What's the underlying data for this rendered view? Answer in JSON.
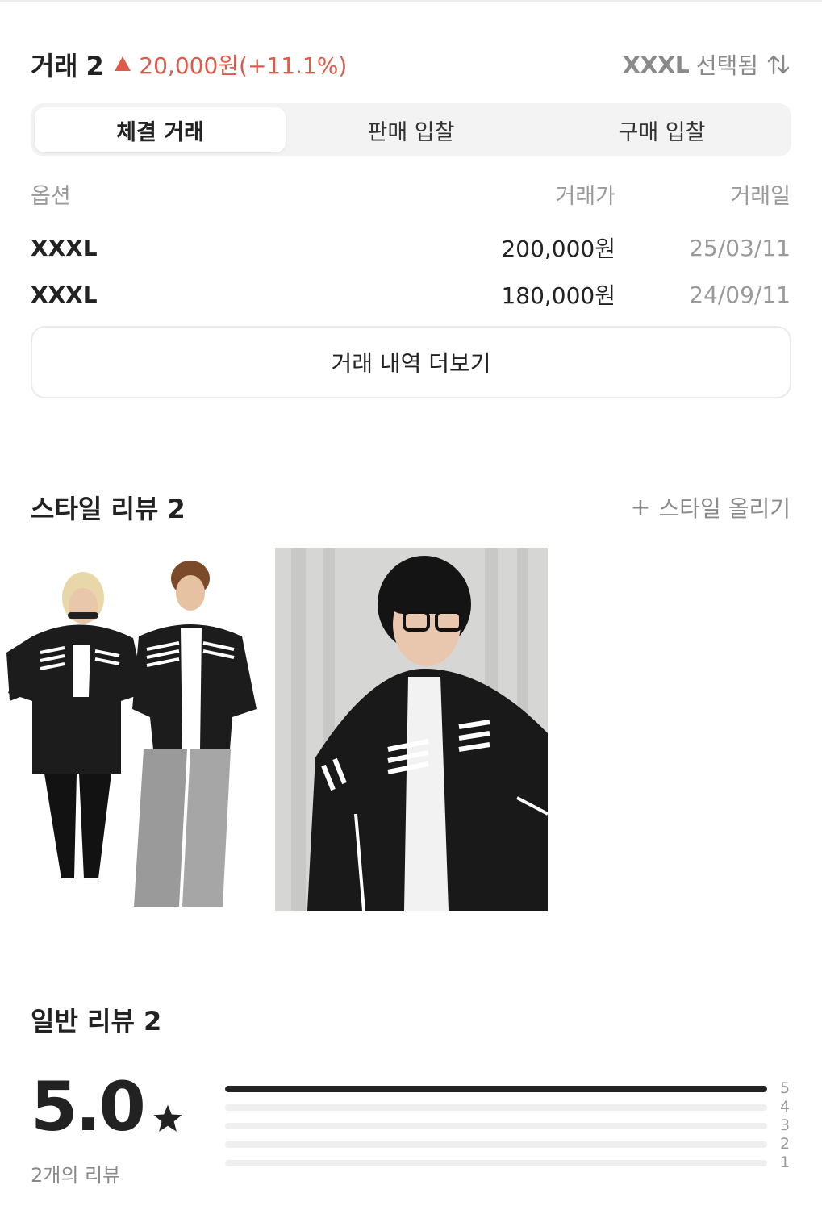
{
  "trade": {
    "title": "거래 2",
    "change": "20,000원(+11.1%)",
    "selected_size": "XXXL",
    "selected_suffix": "선택됨"
  },
  "tabs": [
    {
      "label": "체결 거래",
      "active": true
    },
    {
      "label": "판매 입찰",
      "active": false
    },
    {
      "label": "구매 입찰",
      "active": false
    }
  ],
  "table": {
    "headers": {
      "option": "옵션",
      "price": "거래가",
      "date": "거래일"
    },
    "rows": [
      {
        "option": "XXXL",
        "price": "200,000원",
        "date": "25/03/11"
      },
      {
        "option": "XXXL",
        "price": "180,000원",
        "date": "24/09/11"
      }
    ]
  },
  "more_button": "거래 내역 더보기",
  "style_review": {
    "title": "스타일 리뷰 2",
    "upload": "스타일 올리기"
  },
  "general_review": {
    "title": "일반 리뷰 2",
    "score": "5.0",
    "count_text": "2개의 리뷰",
    "distribution": [
      {
        "label": "5",
        "fraction": 1.0
      },
      {
        "label": "4",
        "fraction": 0
      },
      {
        "label": "3",
        "fraction": 0
      },
      {
        "label": "2",
        "fraction": 0
      },
      {
        "label": "1",
        "fraction": 0
      }
    ]
  },
  "colors": {
    "accent_up": "#e05a48",
    "text": "#222222",
    "muted": "#8a8a8a"
  }
}
